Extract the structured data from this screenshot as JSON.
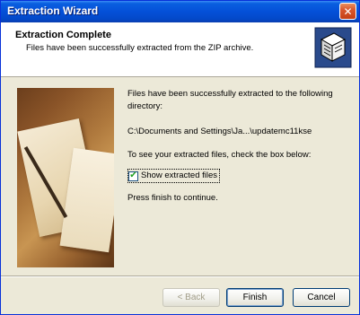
{
  "window": {
    "title": "Extraction Wizard",
    "close_glyph": "✕"
  },
  "header": {
    "title": "Extraction Complete",
    "subtitle": "Files have been successfully extracted from the ZIP archive.",
    "icon": "zip-archive-icon"
  },
  "content": {
    "message": "Files have been successfully extracted to the following directory:",
    "directory": "C:\\Documents and Settings\\Ja...\\updatemc11kse",
    "check_instruction": "To see your extracted files, check the box below:",
    "show_files_label": "Show extracted files",
    "show_files_checked": true,
    "check_glyph": "✔",
    "finish_instruction": "Press finish to continue."
  },
  "buttons": {
    "back_label": "< Back",
    "finish_label": "Finish",
    "cancel_label": "Cancel"
  },
  "colors": {
    "titlebar": "#0450d8",
    "close": "#c43f14",
    "dialog_bg": "#ece9d8"
  }
}
